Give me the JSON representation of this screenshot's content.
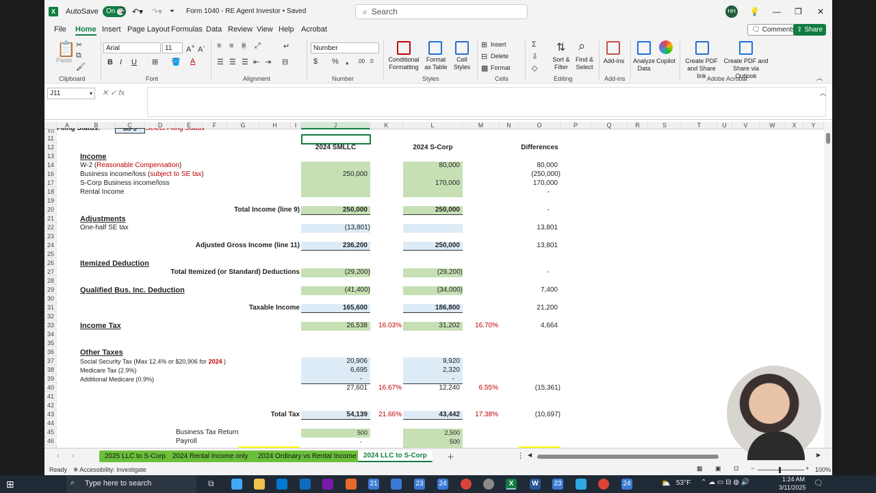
{
  "titlebar": {
    "autosave_label": "AutoSave",
    "autosave_state": "On",
    "doc_title": "Form 1040 - RE Agent Investor • Saved",
    "search_placeholder": "Search",
    "user_initials": "HH"
  },
  "menu": {
    "tabs": [
      "File",
      "Home",
      "Insert",
      "Page Layout",
      "Formulas",
      "Data",
      "Review",
      "View",
      "Help",
      "Acrobat"
    ],
    "active": "Home",
    "comments_label": "Comments",
    "share_label": "Share"
  },
  "ribbon": {
    "paste_label": "Paste",
    "font_name": "Arial",
    "font_size": "11",
    "number_format": "Number",
    "conditional_formatting": "Conditional Formatting",
    "format_as_table": "Format as Table",
    "cell_styles": "Cell Styles",
    "insert": "Insert",
    "delete": "Delete",
    "format": "Format",
    "sort_filter": "Sort & Filter",
    "find_select": "Find & Select",
    "add_ins": "Add-ins",
    "analyze_data": "Analyze Data",
    "copilot": "Copilot",
    "create_pdf_share": "Create PDF and Share link",
    "create_pdf_outlook": "Create PDF and Share via Outlook",
    "groups": {
      "clipboard": "Clipboard",
      "font": "Font",
      "alignment": "Alignment",
      "number": "Number",
      "styles": "Styles",
      "cells": "Cells",
      "editing": "Editing",
      "addins": "Add-ins",
      "adobe": "Adobe Acrobat"
    }
  },
  "formula_bar": {
    "name_box": "J11",
    "fx": "fx",
    "value": ""
  },
  "columns": [
    "A",
    "B",
    "C",
    "D",
    "E",
    "F",
    "G",
    "H",
    "I",
    "J",
    "K",
    "L",
    "M",
    "N",
    "O",
    "P",
    "Q",
    "R",
    "S",
    "T",
    "U",
    "V",
    "W",
    "X",
    "Y"
  ],
  "rows": [
    "10",
    "11",
    "12",
    "13",
    "14",
    "16",
    "17",
    "18",
    "19",
    "20",
    "21",
    "22",
    "23",
    "24",
    "25",
    "26",
    "27",
    "28",
    "29",
    "30",
    "31",
    "32",
    "33",
    "34",
    "35",
    "36",
    "37",
    "38",
    "39",
    "40",
    "41",
    "42",
    "43",
    "44",
    "45",
    "46"
  ],
  "sheet": {
    "r10_label": "Filing Status:",
    "r10_value": "MFJ",
    "r10_note": "Select Filing Status",
    "col_j_header": "2024 SMLLC",
    "col_l_header": "2024 S-Corp",
    "col_o_header": "Differences",
    "income_title": "Income",
    "w2_prefix": "W-2 (",
    "w2_red": "Reasonable Compensation",
    "w2_suffix": ")",
    "biz_prefix": "Business income/loss (",
    "biz_red": "subject to SE tax",
    "biz_suffix": ")",
    "scorp_biz": "S-Corp Business income/loss",
    "rental": "Rental Income",
    "total_income": "Total Income (line 9)",
    "adjustments_title": "Adjustments",
    "half_se": "One-half SE tax",
    "agi": "Adjusted Gross Income (line 11)",
    "itemized_title": "Itemized Deduction",
    "total_itemized": "Total Itemized (or Standard) Deductions",
    "qbi_title": "Qualified Bus. Inc. Deduction",
    "taxable_income": "Taxable Income",
    "income_tax_title": "Income Tax",
    "other_taxes_title": "Other Taxes",
    "ss_tax_prefix": "Social Security Tax (Max 12.4% or $20,906 for ",
    "ss_tax_year": "2024",
    "ss_tax_suffix": " )",
    "medicare": "Medicare Tax (2.9%)",
    "add_medicare": "Additional Medicare (0.9%)",
    "total_tax": "Total Tax",
    "biz_tax_return": "Business Tax Return",
    "payroll": "Payroll",
    "j": {
      "w2": "",
      "biz": "250,000",
      "scorp": "",
      "rental": "",
      "total_income": "250,000",
      "half_se": "(13,801)",
      "agi": "236,200",
      "itemized": "(29,200)",
      "qbi": "(41,400)",
      "taxable": "165,600",
      "income_tax": "26,538",
      "ss": "20,906",
      "medicare": "6,695",
      "add_medicare": "-",
      "other_total": "27,601",
      "total_tax": "54,139",
      "biz_return": "500",
      "payroll": "-"
    },
    "k": {
      "income_tax_pct": "16.03%",
      "other_pct": "16.67%",
      "total_pct": "21.66%"
    },
    "l": {
      "w2": "80,000",
      "biz": "",
      "scorp": "170,000",
      "rental": "",
      "total_income": "250,000",
      "half_se": "",
      "agi": "250,000",
      "itemized": "(29,200)",
      "qbi": "(34,000)",
      "taxable": "186,800",
      "income_tax": "31,202",
      "ss": "9,920",
      "medicare": "2,320",
      "add_medicare": "-",
      "other_total": "12,240",
      "total_tax": "43,442",
      "biz_return": "2,500",
      "payroll": "500"
    },
    "m": {
      "income_tax_pct": "16.70%",
      "other_pct": "6.55%",
      "total_pct": "17.38%"
    },
    "o": {
      "w2": "80,000",
      "biz": "(250,000)",
      "scorp": "170,000",
      "rental": "-",
      "total_income": "-",
      "half_se": "13,801",
      "agi": "13,801",
      "itemized": "-",
      "qbi": "7,400",
      "taxable": "21,200",
      "income_tax": "4,664",
      "other_total": "(15,361)",
      "total_tax": "(10,697)"
    }
  },
  "sheet_tabs": [
    "2025 LLC to S-Corp",
    "2024 Rental Income only",
    "2024 Ordinary vs Rental Income",
    "2024 LLC to S-Corp"
  ],
  "active_sheet": "2024 LLC to S-Corp",
  "status": {
    "ready": "Ready",
    "accessibility": "Accessibility: Investigate",
    "zoom": "100%"
  },
  "taskbar": {
    "search_placeholder": "Type here to search",
    "badges": [
      "21",
      "23",
      "24",
      "23",
      "24"
    ],
    "weather": "53°F",
    "time": "1:24 AM",
    "date": "3/11/2025"
  },
  "colors": {
    "excel_green": "#107c41",
    "fill_green": "#c6e0b4",
    "fill_blue": "#ddebf7",
    "red_text": "#c00000",
    "tab_green": "#6bbf3a"
  }
}
